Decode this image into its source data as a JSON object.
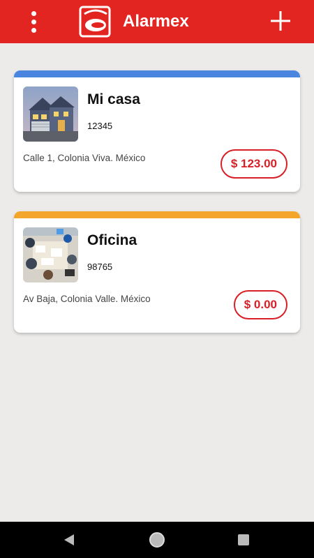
{
  "app": {
    "title": "Alarmex",
    "brand_color": "#e32521"
  },
  "header": {
    "menu_icon": "more-vert-icon",
    "logo": "alarmex-logo",
    "add_icon": "plus-icon"
  },
  "properties": [
    {
      "name": "Mi casa",
      "code": "12345",
      "address": "Calle 1, Colonia Viva. México",
      "balance": "$ 123.00",
      "accent_color": "#4a86e0",
      "image": "house-photo"
    },
    {
      "name": "Oficina",
      "code": "98765",
      "address": "Av Baja, Colonia Valle. México",
      "balance": "$ 0.00",
      "accent_color": "#f4a52c",
      "image": "office-meeting-photo"
    }
  ],
  "system_nav": {
    "back_icon": "back-triangle-icon",
    "home_icon": "home-circle-icon",
    "recents_icon": "recents-square-icon"
  }
}
